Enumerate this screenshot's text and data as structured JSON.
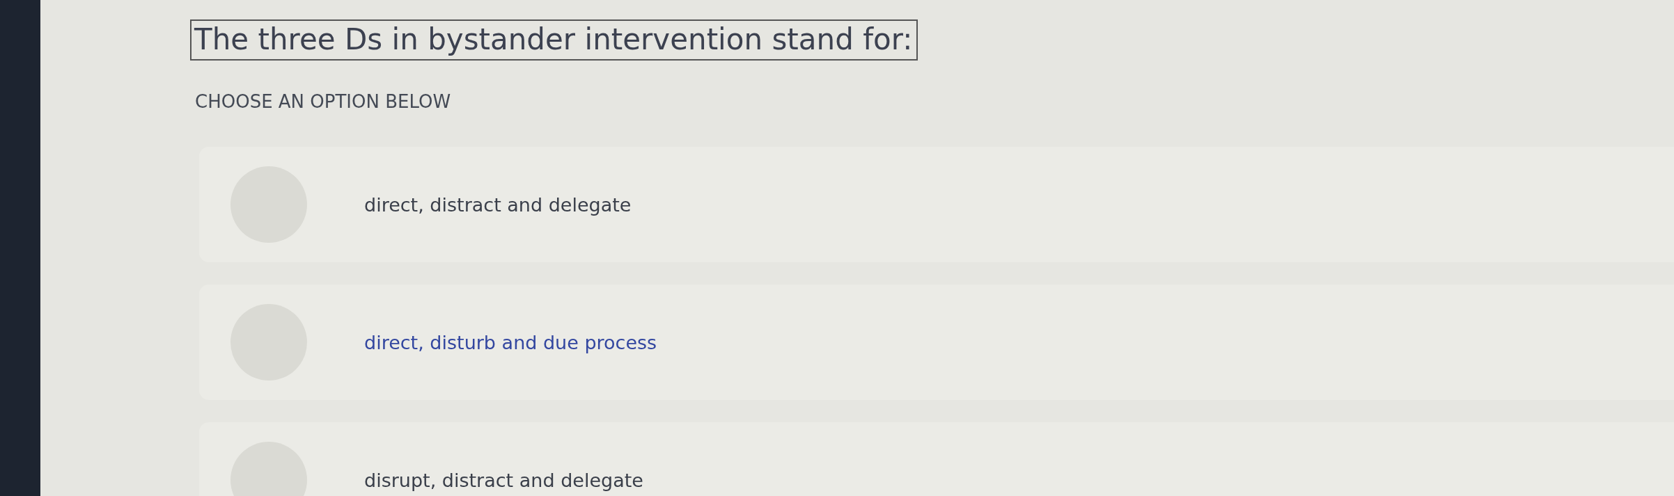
{
  "question": {
    "title": "The three Ds in bystander intervention stand for:",
    "instruction": "CHOOSE AN OPTION BELOW"
  },
  "options": [
    {
      "label": "direct, distract and delegate",
      "hovered": false,
      "selected": false
    },
    {
      "label": "direct, disturb and due process",
      "hovered": true,
      "selected": false
    },
    {
      "label": "disrupt, distract and delegate",
      "hovered": false,
      "selected": false
    }
  ]
}
